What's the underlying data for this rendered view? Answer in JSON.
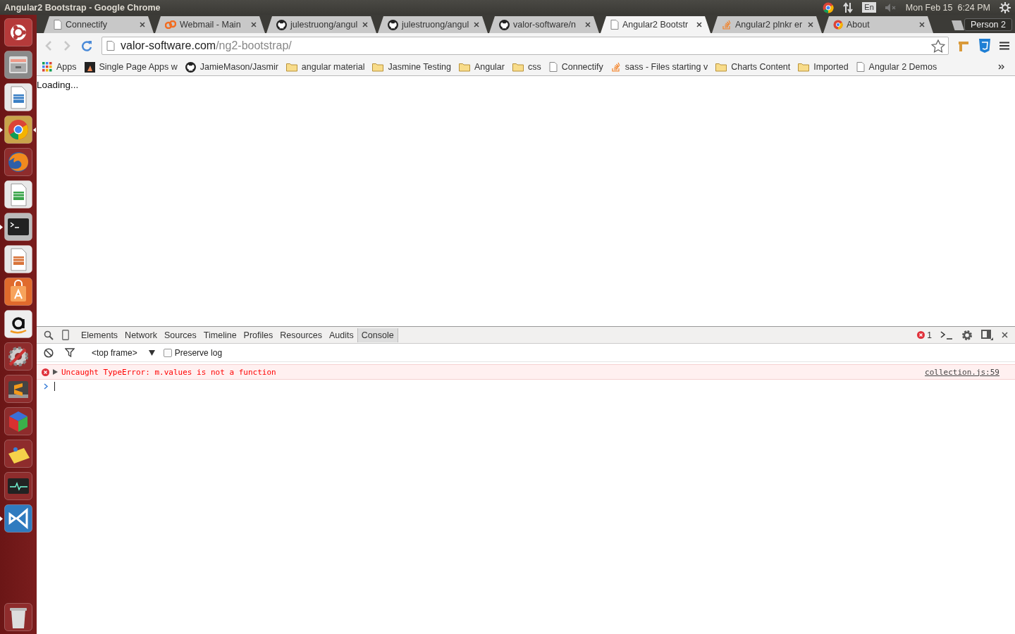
{
  "panel": {
    "title": "Angular2 Bootstrap - Google Chrome",
    "keyboard": "En",
    "clock": "Mon Feb 15  6:24 PM"
  },
  "launcher": [
    {
      "kind": "ubuntu",
      "running": false,
      "focused": false
    },
    {
      "kind": "files",
      "running": false,
      "focused": false
    },
    {
      "kind": "writer",
      "running": false,
      "focused": false
    },
    {
      "kind": "chrome",
      "running": true,
      "focused": true
    },
    {
      "kind": "firefox",
      "running": false,
      "focused": false
    },
    {
      "kind": "calc",
      "running": false,
      "focused": false
    },
    {
      "kind": "terminal",
      "running": true,
      "focused": false
    },
    {
      "kind": "impress",
      "running": false,
      "focused": false
    },
    {
      "kind": "store",
      "running": false,
      "focused": false
    },
    {
      "kind": "amazon",
      "running": false,
      "focused": false
    },
    {
      "kind": "settings",
      "running": false,
      "focused": false
    },
    {
      "kind": "sublime",
      "running": false,
      "focused": false
    },
    {
      "kind": "cube",
      "running": false,
      "focused": false
    },
    {
      "kind": "notes",
      "running": false,
      "focused": false
    },
    {
      "kind": "monitor",
      "running": false,
      "focused": false
    },
    {
      "kind": "vscode",
      "running": true,
      "focused": false
    }
  ],
  "tabs": [
    {
      "title": "Connectify",
      "kind": "page",
      "selected": false
    },
    {
      "title": "Webmail - Main",
      "kind": "cpanel",
      "selected": false
    },
    {
      "title": "julestruong/angul",
      "kind": "github",
      "selected": false
    },
    {
      "title": "julestruong/angul",
      "kind": "github",
      "selected": false
    },
    {
      "title": "valor-software/n",
      "kind": "github",
      "selected": false
    },
    {
      "title": "Angular2 Bootstr",
      "kind": "page",
      "selected": true
    },
    {
      "title": "Angular2 plnkr er",
      "kind": "stack",
      "selected": false
    },
    {
      "title": "About",
      "kind": "chrome",
      "selected": false
    }
  ],
  "profile": "Person 2",
  "address": {
    "host": "valor-software.com",
    "path": "/ng2-bootstrap/"
  },
  "bookmarks": [
    {
      "label": "Apps",
      "kind": "apps"
    },
    {
      "label": "Single Page Apps w",
      "kind": "dark"
    },
    {
      "label": "JamieMason/Jasmir",
      "kind": "github"
    },
    {
      "label": "angular material",
      "kind": "folder"
    },
    {
      "label": "Jasmine Testing",
      "kind": "folder"
    },
    {
      "label": "Angular",
      "kind": "folder"
    },
    {
      "label": "css",
      "kind": "folder"
    },
    {
      "label": "Connectify",
      "kind": "page"
    },
    {
      "label": "sass - Files starting v",
      "kind": "stack"
    },
    {
      "label": "Charts Content",
      "kind": "folder"
    },
    {
      "label": "Imported",
      "kind": "folder"
    },
    {
      "label": "Angular 2 Demos",
      "kind": "page"
    }
  ],
  "page": {
    "text": "Loading..."
  },
  "devtools": {
    "tabs": [
      {
        "label": "Elements",
        "selected": false
      },
      {
        "label": "Network",
        "selected": false
      },
      {
        "label": "Sources",
        "selected": false
      },
      {
        "label": "Timeline",
        "selected": false
      },
      {
        "label": "Profiles",
        "selected": false
      },
      {
        "label": "Resources",
        "selected": false
      },
      {
        "label": "Audits",
        "selected": false
      },
      {
        "label": "Console",
        "selected": true
      }
    ],
    "error_count": "1",
    "frame": "<top frame>",
    "preserve_log": {
      "label": "Preserve log",
      "checked": false
    },
    "messages": [
      {
        "kind": "error",
        "text": "Uncaught TypeError: m.values is not a function",
        "source": "collection.js:59"
      }
    ]
  }
}
